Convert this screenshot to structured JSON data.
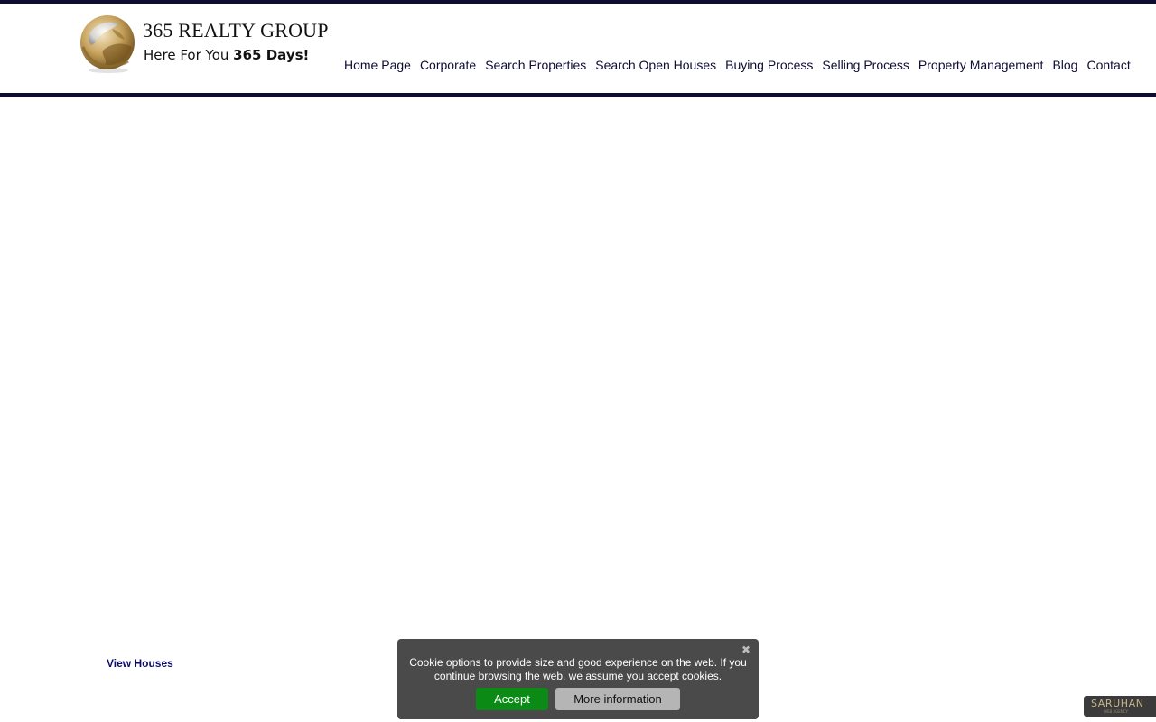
{
  "brand": {
    "name": "365 REALTY GROUP",
    "tagline_prefix": "Here For You ",
    "tagline_bold": "365 Days!",
    "globe_icon": "globe-icon",
    "colors": {
      "navy": "#0e0c33",
      "gold": "#b08d4a"
    }
  },
  "nav": {
    "items": [
      {
        "label": "Home Page"
      },
      {
        "label": "Corporate"
      },
      {
        "label": "Search Properties"
      },
      {
        "label": "Search Open Houses"
      },
      {
        "label": "Buying Process"
      },
      {
        "label": "Selling Process"
      },
      {
        "label": "Property Management"
      },
      {
        "label": "Blog"
      },
      {
        "label": "Contact"
      }
    ]
  },
  "main": {
    "view_houses_label": "View Houses"
  },
  "cookie": {
    "close_glyph": "✖",
    "close_icon": "close-icon",
    "message": "Cookie options to provide size and good experience on the web. If you continue browsing the web, we assume you accept cookies.",
    "accept_label": "Accept",
    "more_label": "More information",
    "colors": {
      "background": "#4a4a4a",
      "accept": "#0b8a16",
      "more": "#b5b5b5"
    }
  },
  "badge": {
    "label": "SARUHAN",
    "sub": "WEB AGENCY"
  }
}
